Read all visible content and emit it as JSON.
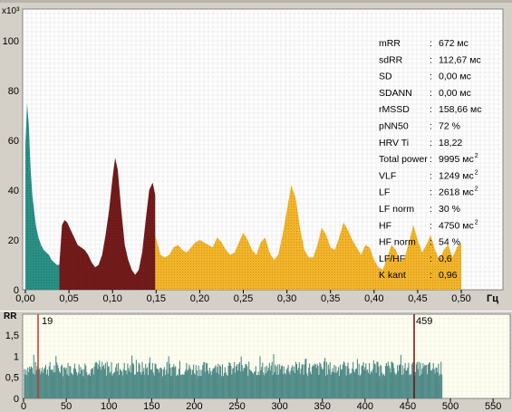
{
  "spectrum": {
    "y_unit": "x10³",
    "x_unit": "Гц",
    "y_ticks": [
      "0",
      "20",
      "40",
      "60",
      "80",
      "100"
    ],
    "x_ticks": [
      "0,00",
      "0,05",
      "0,10",
      "0,15",
      "0,20",
      "0,25",
      "0,30",
      "0,35",
      "0,40",
      "0,45",
      "0,50"
    ],
    "stats": [
      {
        "name": "mRR",
        "value": "672",
        "unit": "мс",
        "sup": ""
      },
      {
        "name": "sdRR",
        "value": "112,67",
        "unit": "мс",
        "sup": ""
      },
      {
        "name": "SD",
        "value": "0,00",
        "unit": "мс",
        "sup": ""
      },
      {
        "name": "SDANN",
        "value": "0,00",
        "unit": "мс",
        "sup": ""
      },
      {
        "name": "rMSSD",
        "value": "158,66",
        "unit": "мс",
        "sup": ""
      },
      {
        "name": "pNN50",
        "value": "72",
        "unit": "%",
        "sup": ""
      },
      {
        "name": "HRV Ti",
        "value": "18,22",
        "unit": "",
        "sup": ""
      },
      {
        "name": "Total power",
        "value": "9995",
        "unit": "мс",
        "sup": "2"
      },
      {
        "name": "VLF",
        "value": "1249",
        "unit": "мс",
        "sup": "2"
      },
      {
        "name": "LF",
        "value": "2618",
        "unit": "мс",
        "sup": "2"
      },
      {
        "name": "LF norm",
        "value": "30",
        "unit": "%",
        "sup": ""
      },
      {
        "name": "HF",
        "value": "4750",
        "unit": "мс",
        "sup": "2"
      },
      {
        "name": "HF norm",
        "value": "54",
        "unit": "%",
        "sup": ""
      },
      {
        "name": "LF/HF",
        "value": "0,6",
        "unit": "",
        "sup": ""
      },
      {
        "name": "K kant",
        "value": "0,96",
        "unit": "",
        "sup": ""
      }
    ]
  },
  "rr_chart": {
    "y_unit": "RR",
    "y_ticks": [
      "0",
      "0,5",
      "1",
      "1,5"
    ],
    "x_ticks": [
      "0",
      "50",
      "100",
      "150",
      "200",
      "250",
      "300",
      "350",
      "400",
      "450",
      "500",
      "550"
    ],
    "marker_left_label": "19",
    "marker_right_label": "459"
  },
  "colors": {
    "vlf": "#1f8a80",
    "lf": "#6b0f0f",
    "hf": "#f2b01e",
    "rr_bars": "#4f8a86",
    "background": "#ffffff",
    "rr_background": "#fffff2",
    "marker": "#c0392b"
  },
  "chart_data": [
    {
      "type": "area",
      "xlabel": "Гц",
      "ylabel": "x10³",
      "xlim": [
        0,
        0.5
      ],
      "ylim": [
        0,
        105
      ],
      "grid": true,
      "series": [
        {
          "x": [
            0.0,
            0.002,
            0.004,
            0.006,
            0.008,
            0.01,
            0.012,
            0.015,
            0.018,
            0.021,
            0.024,
            0.027,
            0.03,
            0.033,
            0.036,
            0.039
          ],
          "y": [
            58,
            75,
            66,
            48,
            38,
            32,
            26,
            21,
            18,
            16,
            15,
            14,
            12,
            11,
            10,
            10
          ]
        },
        {
          "x": [
            0.039,
            0.042,
            0.045,
            0.048,
            0.052,
            0.056,
            0.06,
            0.064,
            0.068,
            0.072,
            0.076,
            0.08,
            0.084,
            0.088,
            0.092,
            0.096,
            0.1,
            0.103,
            0.106,
            0.11,
            0.114,
            0.118,
            0.122,
            0.126,
            0.13,
            0.134,
            0.138,
            0.142,
            0.146,
            0.149
          ],
          "y": [
            10,
            26,
            28,
            27,
            24,
            21,
            18,
            17,
            16,
            14,
            11,
            9,
            10,
            14,
            22,
            32,
            45,
            53,
            48,
            32,
            18,
            12,
            8,
            6,
            8,
            15,
            28,
            40,
            43,
            38
          ]
        },
        {
          "x": [
            0.149,
            0.155,
            0.16,
            0.165,
            0.17,
            0.175,
            0.18,
            0.185,
            0.19,
            0.195,
            0.2,
            0.205,
            0.21,
            0.215,
            0.22,
            0.225,
            0.23,
            0.235,
            0.24,
            0.245,
            0.25,
            0.255,
            0.26,
            0.265,
            0.27,
            0.275,
            0.28,
            0.285,
            0.29,
            0.295,
            0.3,
            0.305,
            0.31,
            0.315,
            0.32,
            0.325,
            0.33,
            0.335,
            0.34,
            0.345,
            0.35,
            0.355,
            0.36,
            0.365,
            0.37,
            0.375,
            0.38,
            0.385,
            0.39,
            0.395,
            0.4,
            0.405,
            0.41,
            0.415,
            0.42,
            0.425,
            0.43,
            0.435,
            0.44,
            0.445,
            0.45,
            0.455,
            0.46,
            0.465,
            0.47,
            0.475,
            0.48,
            0.485,
            0.49,
            0.495,
            0.5
          ],
          "y": [
            22,
            14,
            13,
            14,
            17,
            18,
            16,
            15,
            17,
            19,
            20,
            19,
            18,
            17,
            21,
            19,
            16,
            14,
            15,
            19,
            23,
            20,
            16,
            14,
            19,
            21,
            15,
            12,
            14,
            22,
            32,
            42,
            37,
            25,
            16,
            13,
            13,
            18,
            25,
            22,
            17,
            16,
            21,
            27,
            24,
            20,
            17,
            14,
            18,
            17,
            12,
            9,
            8,
            13,
            18,
            16,
            11,
            13,
            19,
            26,
            20,
            15,
            18,
            22,
            16,
            12,
            16,
            18,
            13,
            17,
            19
          ]
        }
      ]
    },
    {
      "type": "bar",
      "xlabel": "",
      "ylabel": "RR",
      "xlim": [
        0,
        570
      ],
      "ylim": [
        0,
        1.8
      ],
      "x": [
        1,
        490
      ],
      "values": [
        0.7,
        0.8
      ]
    }
  ]
}
